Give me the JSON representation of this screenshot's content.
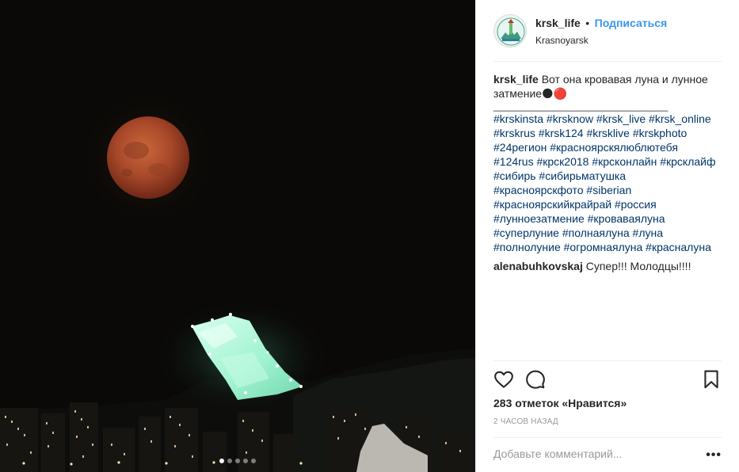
{
  "post": {
    "username": "krsk_life",
    "separator": "•",
    "follow_label": "Подписаться",
    "location": "Krasnoyarsk",
    "avatar_icon": "krsk-city-logo-icon",
    "caption_user": "krsk_life",
    "caption_text": "Вот она кровавая луна и лунное затмение🌑🔴",
    "caption_divider": "_________________________________",
    "hashtags": "#krskinsta #krsknow #krsk_live #krsk_online\n#krskrus #krsk124 #krsklive #krskphoto\n#24регион #красноярскялюблютебя\n#124rus #крск2018 #крсконлайн #крсклайф\n#сибирь #сибирьматушка\n#красноярскфото  #siberian\n#красноярскийкрайрай #россия\n#лунноезатмение #кроваваялуна\n#суперлуние #полнаялуна #луна\n#полнолуние #огромнаялуна #красналуна",
    "comments": [
      {
        "user": "alenabuhkovskaj",
        "text": "Супер!!! Молодцы!!!!"
      }
    ],
    "likes_count": "283 отметок «Нравится»",
    "timestamp": "2 ЧАСОВ НАЗАД",
    "add_comment_placeholder": "Добавьте комментарий...",
    "more_icon": "more-options-icon",
    "icons": {
      "like": "heart-icon",
      "comment": "comment-bubble-icon",
      "save": "bookmark-icon"
    },
    "carousel": {
      "total": 5,
      "active": 1
    }
  },
  "colors": {
    "link": "#3897f0",
    "hashtag": "#003569",
    "muted": "#999999",
    "border": "#efefef",
    "moon": "#b5502b"
  }
}
